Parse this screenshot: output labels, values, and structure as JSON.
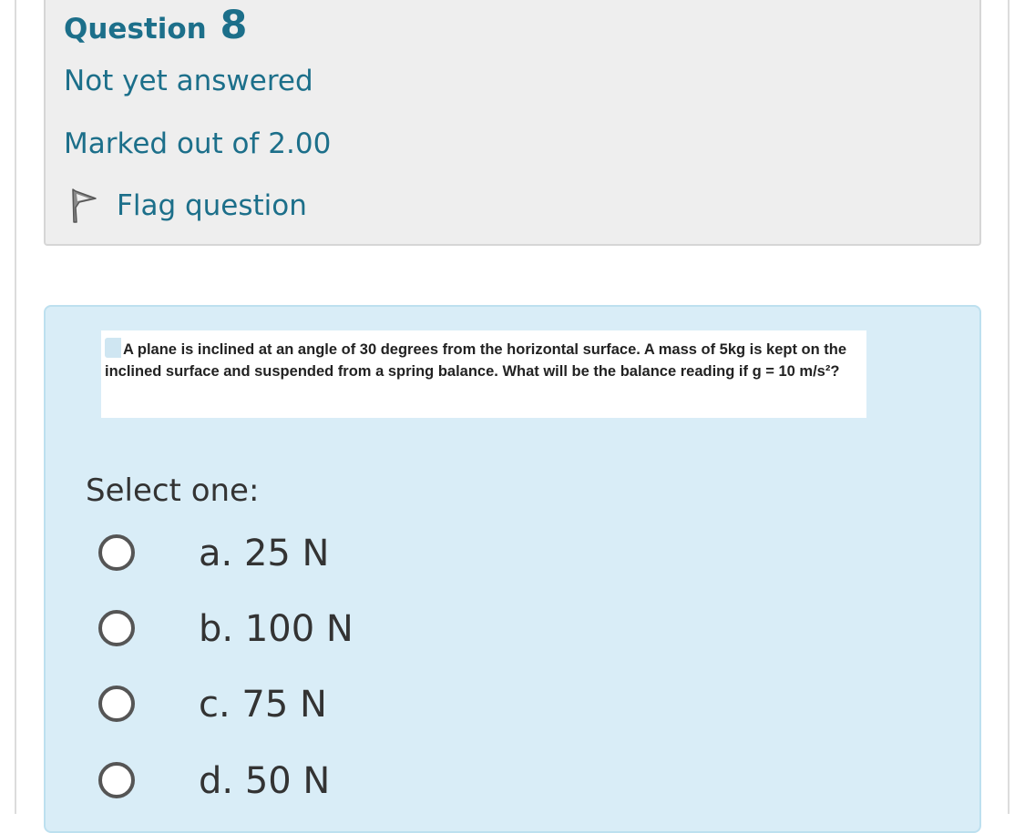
{
  "question_info": {
    "title_word": "Question",
    "number": "8",
    "state": "Not yet answered",
    "grade": "Marked out of 2.00",
    "flag_label": "Flag question"
  },
  "question": {
    "text": "A plane is inclined at an angle of 30 degrees from the horizontal surface. A mass of 5kg is kept on the inclined surface and suspended from a spring balance. What will be the balance reading if g = 10 m/s²?",
    "prompt": "Select one:",
    "options": [
      {
        "label": "a. 25 N",
        "selected": false
      },
      {
        "label": "b. 100 N",
        "selected": false
      },
      {
        "label": "c. 75 N",
        "selected": false
      },
      {
        "label": "d. 50 N",
        "selected": false
      }
    ]
  },
  "colors": {
    "accent_text": "#1c6f8a",
    "info_background": "#eeeeee",
    "content_background": "#d9edf7"
  },
  "icons": {
    "flag": "flag-icon",
    "radio": "radio-unchecked"
  }
}
